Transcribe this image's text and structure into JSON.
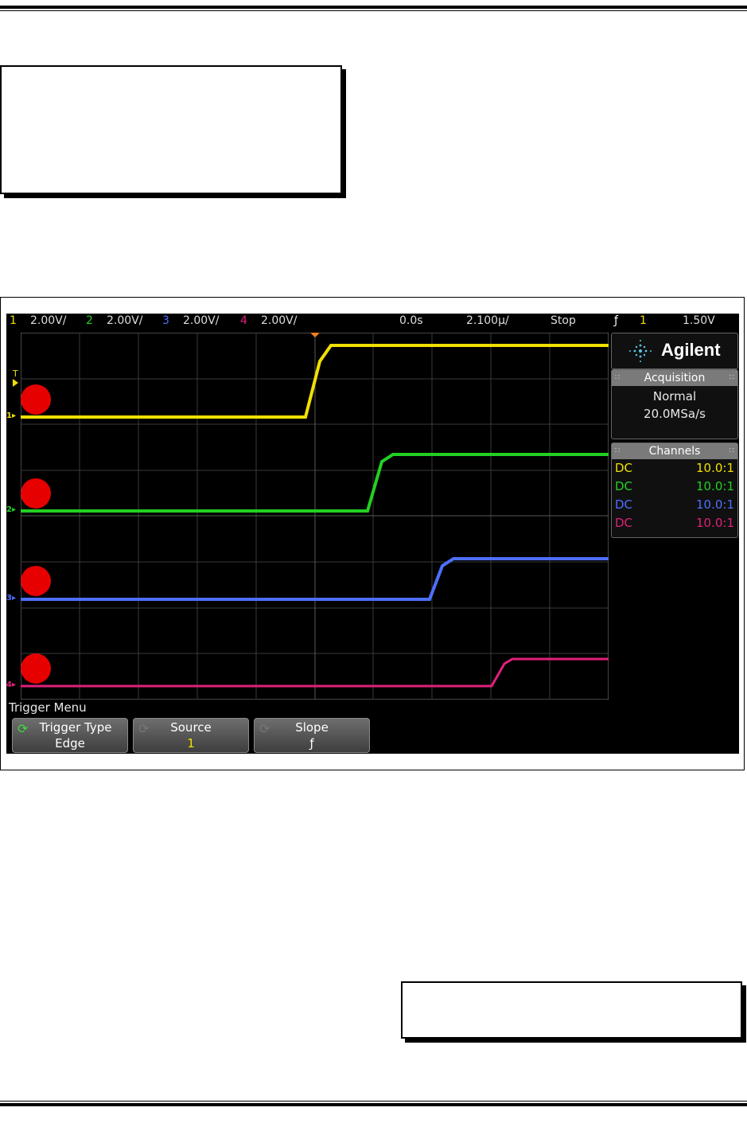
{
  "status_bar": {
    "ch1_num": "1",
    "ch1_scale": "2.00V/",
    "ch2_num": "2",
    "ch2_scale": "2.00V/",
    "ch3_num": "3",
    "ch3_scale": "2.00V/",
    "ch4_num": "4",
    "ch4_scale": "2.00V/",
    "time_delay": "0.0s",
    "time_scale": "2.100µ/",
    "run_state": "Stop",
    "trigger_slope_symbol": "ƒ",
    "trigger_source": "1",
    "trigger_level": "1.50V"
  },
  "brand": {
    "name": "Agilent",
    "logo_icon": "agilent-spark-icon"
  },
  "acquisition": {
    "title": "Acquisition",
    "mode": "Normal",
    "rate": "20.0MSa/s"
  },
  "channels": {
    "title": "Channels",
    "rows": [
      {
        "coupling": "DC",
        "probe": "10.0:1",
        "color": "#f0e000"
      },
      {
        "coupling": "DC",
        "probe": "10.0:1",
        "color": "#22d022"
      },
      {
        "coupling": "DC",
        "probe": "10.0:1",
        "color": "#4d6fff"
      },
      {
        "coupling": "DC",
        "probe": "10.0:1",
        "color": "#e0207a"
      }
    ]
  },
  "ground_labels": [
    "1",
    "2",
    "3",
    "4"
  ],
  "trigger_marker_label": "T",
  "trigger_menu": {
    "title": "Trigger Menu",
    "keys": [
      {
        "label": "Trigger Type",
        "value": "Edge"
      },
      {
        "label": "Source",
        "value": "1"
      },
      {
        "label": "Slope",
        "value": "ƒ"
      }
    ]
  },
  "colors": {
    "ch1": "#f0e000",
    "ch2": "#22d022",
    "ch3": "#4d6fff",
    "ch4": "#e0207a",
    "marker": "#e60000",
    "grid": "#3a3a3a"
  }
}
